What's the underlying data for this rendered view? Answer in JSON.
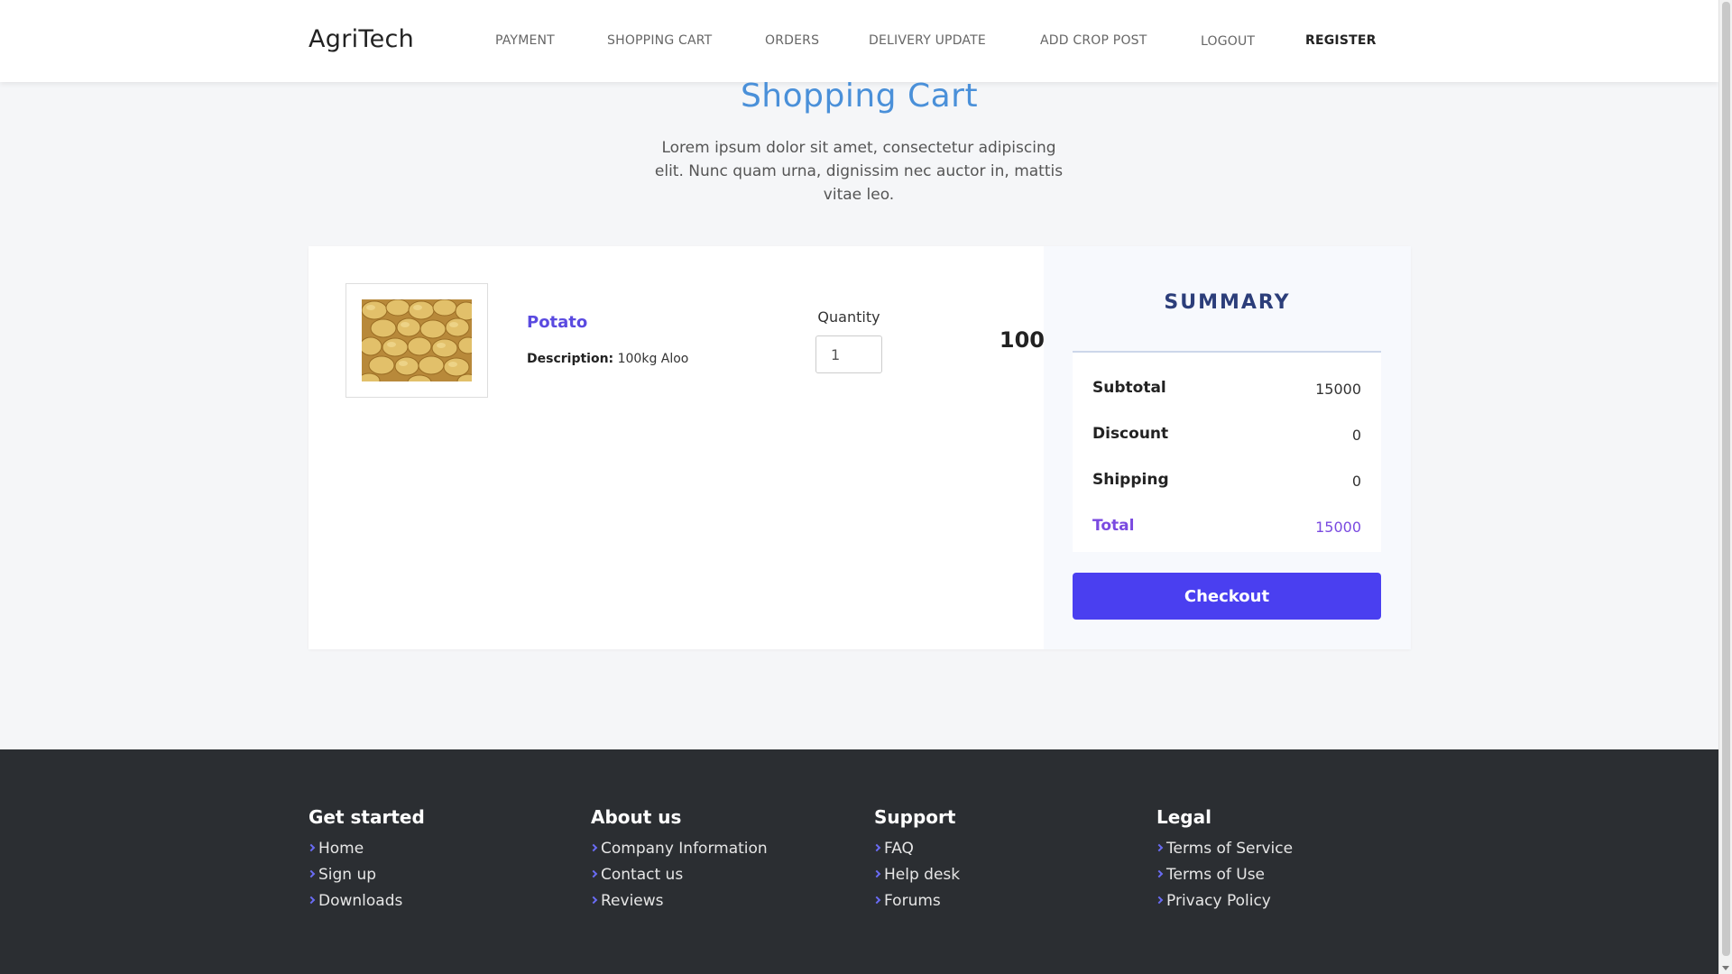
{
  "nav": {
    "brand": "AgriTech",
    "items": [
      {
        "label": "PAYMENT"
      },
      {
        "label": "SHOPPING CART"
      },
      {
        "label": "ORDERS"
      },
      {
        "label": "DELIVERY UPDATE"
      },
      {
        "label": "ADD CROP POST"
      },
      {
        "label": "LOGOUT"
      },
      {
        "label": "REGISTER"
      }
    ]
  },
  "hero": {
    "title": "Shopping Cart",
    "text": "Lorem ipsum dolor sit amet, consectetur adipiscing elit. Nunc quam urna, dignissim nec auctor in, mattis vitae leo."
  },
  "cart": {
    "item": {
      "name": "Potato",
      "desc_label": "Description:",
      "desc_value": "100kg Aloo",
      "qty_label": "Quantity",
      "qty_value": "1",
      "price": "100"
    },
    "summary": {
      "title": "SUMMARY",
      "rows": [
        {
          "label": "Subtotal",
          "value": "15000"
        },
        {
          "label": "Discount",
          "value": "0"
        },
        {
          "label": "Shipping",
          "value": "0"
        },
        {
          "label": "Total",
          "value": "15000"
        }
      ],
      "checkout_label": "Checkout"
    }
  },
  "footer": {
    "columns": [
      {
        "title": "Get started",
        "links": [
          "Home",
          "Sign up",
          "Downloads"
        ]
      },
      {
        "title": "About us",
        "links": [
          "Company Information",
          "Contact us",
          "Reviews"
        ]
      },
      {
        "title": "Support",
        "links": [
          "FAQ",
          "Help desk",
          "Forums"
        ]
      },
      {
        "title": "Legal",
        "links": [
          "Terms of Service",
          "Terms of Use",
          "Privacy Policy"
        ]
      }
    ]
  },
  "colors": {
    "accent": "#4a3ff0",
    "title_blue": "#4a90d9",
    "product_purple": "#5a4ae0",
    "footer_bg": "#2b2e32"
  }
}
